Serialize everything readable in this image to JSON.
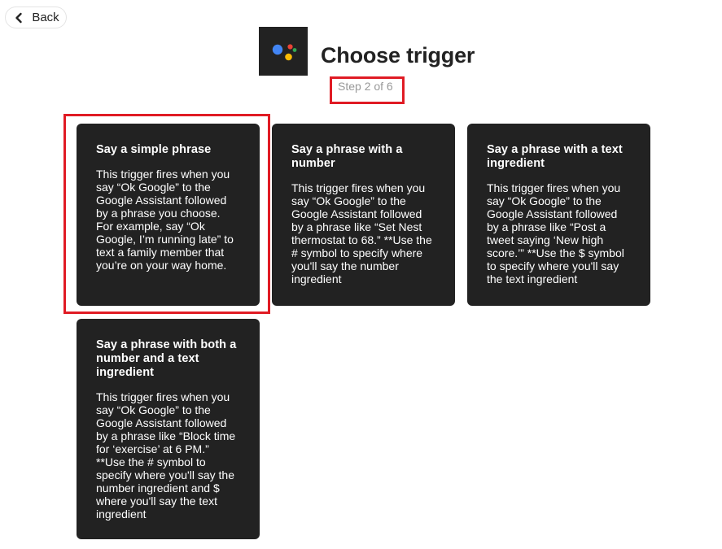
{
  "back": {
    "label": "Back",
    "icon": "chevron-left-icon"
  },
  "header": {
    "service_icon": "google-assistant-icon",
    "title": "Choose trigger",
    "step": "Step 2 of 6"
  },
  "colors": {
    "card_background": "#222222",
    "highlight": "#e01b24",
    "assistant_blue": "#4285F4",
    "assistant_red": "#EA4335",
    "assistant_yellow": "#FBBC05",
    "assistant_green": "#34A853"
  },
  "triggers": [
    {
      "title": "Say a simple phrase",
      "description": "This trigger fires when you say “Ok Google” to the Google Assistant followed by a phrase you choose. For example, say “Ok Google, I’m running late” to text a family member that you’re on your way home."
    },
    {
      "title": "Say a phrase with a number",
      "description": "This trigger fires when you say “Ok Google” to the Google Assistant followed by a phrase like “Set Nest thermostat to 68.” **Use the # symbol to specify where you'll say the number ingredient"
    },
    {
      "title": "Say a phrase with a text ingredient",
      "description": "This trigger fires when you say “Ok Google” to the Google Assistant followed by a phrase like “Post a tweet saying ‘New high score.’” **Use the $ symbol to specify where you'll say the text ingredient"
    },
    {
      "title": "Say a phrase with both a number and a text ingredient",
      "description": "This trigger fires when you say “Ok Google” to the Google Assistant followed by a phrase like “Block time for ‘exercise’ at 6 PM.” **Use the # symbol to specify where you'll say the number ingredient and $ where you'll say the text ingredient"
    }
  ]
}
